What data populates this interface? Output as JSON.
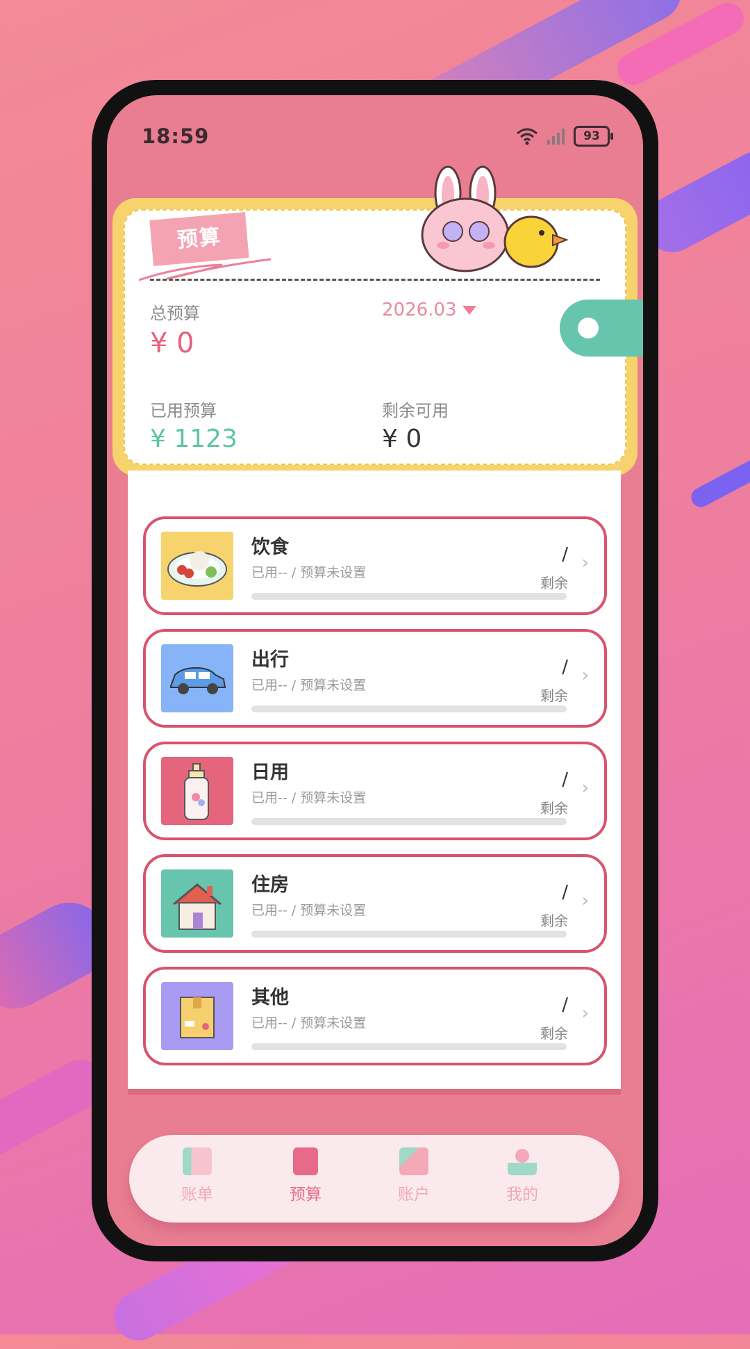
{
  "status_bar": {
    "time": "18:59",
    "battery": "93"
  },
  "budget": {
    "tag_label": "预算",
    "total_label": "总预算",
    "total_value": "¥ 0",
    "month": "2026.03",
    "used_label": "已用预算",
    "used_value": "¥ 1123",
    "remaining_label": "剩余可用",
    "remaining_value": "¥ 0"
  },
  "categories": [
    {
      "name": "饮食",
      "detail": "已用-- / 预算未设置",
      "amount": "/",
      "remain_label": "剩余",
      "icon": "food-plate-icon",
      "icon_bg": "#f6d36d"
    },
    {
      "name": "出行",
      "detail": "已用-- / 预算未设置",
      "amount": "/",
      "remain_label": "剩余",
      "icon": "car-icon",
      "icon_bg": "#86b4f6"
    },
    {
      "name": "日用",
      "detail": "已用-- / 预算未设置",
      "amount": "/",
      "remain_label": "剩余",
      "icon": "lotion-bottle-icon",
      "icon_bg": "#e5657d"
    },
    {
      "name": "住房",
      "detail": "已用-- / 预算未设置",
      "amount": "/",
      "remain_label": "剩余",
      "icon": "house-icon",
      "icon_bg": "#67c5ae"
    },
    {
      "name": "其他",
      "detail": "已用-- / 预算未设置",
      "amount": "/",
      "remain_label": "剩余",
      "icon": "box-icon",
      "icon_bg": "#a99af2"
    }
  ],
  "nav": [
    {
      "label": "账单",
      "icon": "bill-icon",
      "active": false
    },
    {
      "label": "预算",
      "icon": "budget-icon",
      "active": true
    },
    {
      "label": "账户",
      "icon": "wallet-icon",
      "active": false
    },
    {
      "label": "我的",
      "icon": "profile-icon",
      "active": false
    }
  ],
  "colors": {
    "accent_pink": "#e86a88",
    "used_green": "#5cc3a6",
    "card_yellow": "#f6d36d",
    "border_red": "#d9536f"
  }
}
